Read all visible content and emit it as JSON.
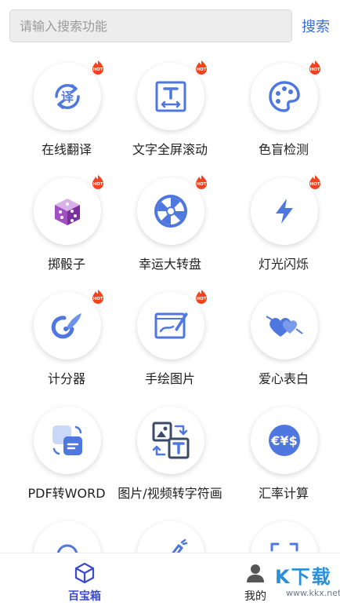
{
  "search": {
    "placeholder": "请输入搜索功能",
    "button_label": "搜索"
  },
  "tools": [
    {
      "label": "在线翻译",
      "icon": "translate-icon",
      "hot": true
    },
    {
      "label": "文字全屏滚动",
      "icon": "text-scroll-icon",
      "hot": true
    },
    {
      "label": "色盲检测",
      "icon": "palette-icon",
      "hot": true
    },
    {
      "label": "掷骰子",
      "icon": "dice-icon",
      "hot": true
    },
    {
      "label": "幸运大转盘",
      "icon": "wheel-icon",
      "hot": true
    },
    {
      "label": "灯光闪烁",
      "icon": "lightning-icon",
      "hot": true
    },
    {
      "label": "计分器",
      "icon": "score-icon",
      "hot": true
    },
    {
      "label": "手绘图片",
      "icon": "drawing-icon",
      "hot": true
    },
    {
      "label": "爱心表白",
      "icon": "hearts-icon",
      "hot": false
    },
    {
      "label": "PDF转WORD",
      "icon": "pdf-convert-icon",
      "hot": false
    },
    {
      "label": "图片/视频转字符画",
      "icon": "image-to-text-icon",
      "hot": false
    },
    {
      "label": "汇率计算",
      "icon": "currency-icon",
      "hot": false
    }
  ],
  "hot_badge_text": "HOT",
  "bottom_nav": {
    "tabs": [
      {
        "label": "百宝箱",
        "icon": "cube-icon",
        "active": true
      },
      {
        "label": "我的",
        "icon": "user-icon",
        "active": false
      }
    ]
  },
  "watermark": {
    "text": "K下载",
    "url": "www.kkx.net"
  },
  "colors": {
    "accent": "#3e6dd8",
    "icon_blue": "#4f77e0",
    "hot_red": "#f4421e",
    "active_tab": "#3b4ad1"
  }
}
